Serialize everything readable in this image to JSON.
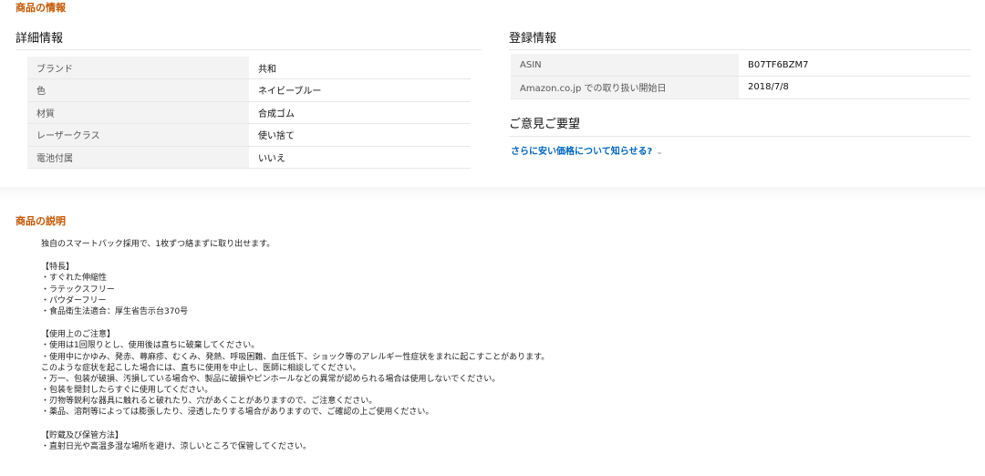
{
  "product_info": {
    "title": "商品の情報",
    "detail": {
      "heading": "詳細情報",
      "rows": [
        {
          "key": "ブランド",
          "value": "共和"
        },
        {
          "key": "色",
          "value": "ネイビーブルー"
        },
        {
          "key": "材質",
          "value": "合成ゴム"
        },
        {
          "key": "レーザークラス",
          "value": "使い捨て"
        },
        {
          "key": "電池付属",
          "value": "いいえ"
        }
      ]
    },
    "registration": {
      "heading": "登録情報",
      "rows": [
        {
          "key": "ASIN",
          "value": "B07TF6BZM7"
        },
        {
          "key": "Amazon.co.jp での取り扱い開始日",
          "value": "2018/7/8"
        }
      ]
    },
    "feedback": {
      "heading": "ご意見ご要望",
      "link_label": "さらに安い価格について知らせる?",
      "chevron": "⌄"
    }
  },
  "description": {
    "title": "商品の説明",
    "blocks": [
      [
        "独自のスマートパック採用で、1枚ずつ絡まずに取り出せます。"
      ],
      [
        "【特長】",
        "・すぐれた伸縮性",
        "・ラテックスフリー",
        "・パウダーフリー",
        "・食品衛生法適合：厚生省告示台370号"
      ],
      [
        "【使用上のご注意】",
        "・使用は1回限りとし、使用後は直ちに破棄してください。",
        "・使用中にかゆみ、発赤、蕁麻疹、むくみ、発熱、呼吸困難、血圧低下、ショック等のアレルギー性症状をまれに起こすことがあります。",
        "このような症状を起こした場合には、直ちに使用を中止し、医師に相談してください。",
        "・万一、包装が破損、汚損している場合や、製品に破損やピンホールなどの異常が認められる場合は使用しないでください。",
        "・包装を開封したらすぐに使用してください。",
        "・刃物等鋭利な器具に触れると破れたり、穴があくことがありますので、ご注意ください。",
        "・薬品、溶剤等によっては膨張したり、浸透したりする場合がありますので、ご確認の上ご使用ください。"
      ],
      [
        "【貯蔵及び保管方法】",
        "・直射日光や高温多湿な場所を避け、涼しいところで保管してください。"
      ]
    ]
  }
}
